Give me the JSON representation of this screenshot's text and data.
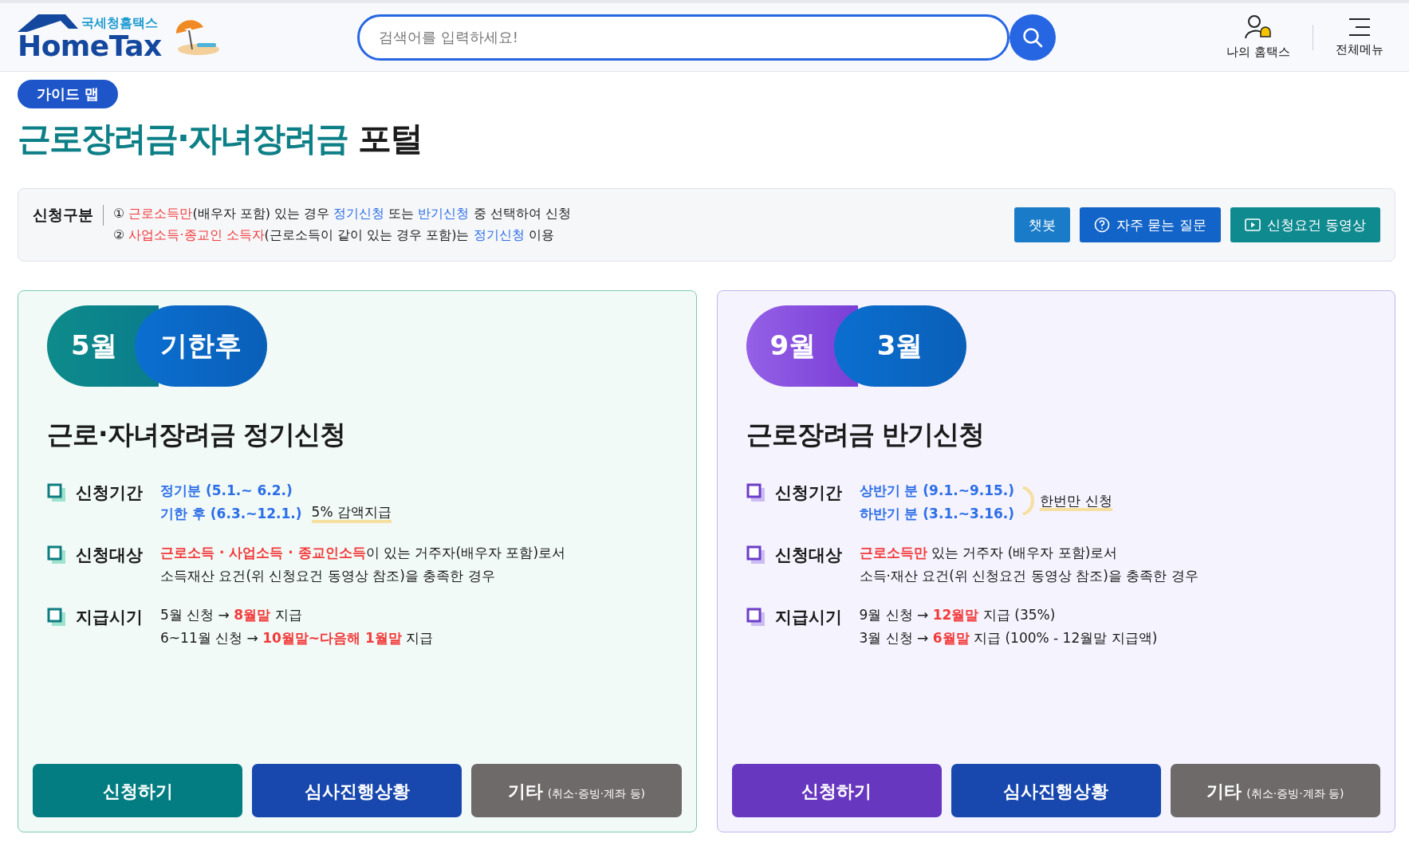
{
  "header": {
    "logo_small": "국세청홈택스",
    "logo_big": "HomeTax",
    "search": {
      "placeholder": "검색어를 입력하세요!"
    },
    "links": [
      {
        "label": "나의 홈택스",
        "kind": "user"
      },
      {
        "label": "전체메뉴",
        "kind": "menu"
      }
    ]
  },
  "badge": "가이드 맵",
  "title": {
    "accent": "근로장려금·자녀장려금",
    "rest": "포털"
  },
  "info": {
    "label": "신청구분",
    "lines": [
      [
        {
          "text": "① ",
          "kind": "plain"
        },
        {
          "text": "근로소득만",
          "kind": "red"
        },
        {
          "text": "(배우자 포함) 있는 경우 ",
          "kind": "plain"
        },
        {
          "text": "정기신청",
          "kind": "blue"
        },
        {
          "text": " 또는 ",
          "kind": "plain"
        },
        {
          "text": "반기신청",
          "kind": "blue"
        },
        {
          "text": " 중 선택하여 신청",
          "kind": "plain"
        }
      ],
      [
        {
          "text": "② ",
          "kind": "plain"
        },
        {
          "text": "사업소득·종교인 소득자",
          "kind": "red"
        },
        {
          "text": "(근로소득이 같이 있는 경우 포함)는 ",
          "kind": "plain"
        },
        {
          "text": "정기신청",
          "kind": "blue"
        },
        {
          "text": " 이용",
          "kind": "plain"
        }
      ]
    ],
    "buttons": [
      {
        "label": "챗봇",
        "kind": "chatbot"
      },
      {
        "label": "자주 묻는 질문",
        "kind": "faq"
      },
      {
        "label": "신청요건 동영상",
        "kind": "video"
      }
    ]
  },
  "cards": [
    {
      "kind": "regular",
      "pill": [
        "5월",
        "기한후"
      ],
      "title": "근로·자녀장려금 정기신청",
      "rows": [
        {
          "label": "신청기간",
          "lines": [
            [
              {
                "text": "정기분 (5.1.~ 6.2.)",
                "kind": "blue"
              }
            ],
            [
              {
                "text": "기한 후 (6.3.~12.1.)",
                "kind": "blue"
              }
            ]
          ],
          "note": "5% 감액지급",
          "kind": "inline"
        },
        {
          "label": "신청대상",
          "lines": [
            [
              {
                "text": "근로소득 · 사업소득 · 종교인소득",
                "kind": "red"
              },
              {
                "text": "이 있는 거주자(배우자 포함)로서",
                "kind": "plain"
              }
            ],
            [
              {
                "text": "소득재산 요건(위 신청요건 동영상 참조)을 충족한 경우",
                "kind": "plain"
              }
            ]
          ]
        },
        {
          "label": "지급시기",
          "lines": [
            [
              {
                "text": "5월 신청 → ",
                "kind": "plain"
              },
              {
                "text": "8월말",
                "kind": "red"
              },
              {
                "text": " 지급",
                "kind": "plain"
              }
            ],
            [
              {
                "text": "6~11월 신청 → ",
                "kind": "plain"
              },
              {
                "text": "10월말~다음해 1월말",
                "kind": "red"
              },
              {
                "text": " 지급",
                "kind": "plain"
              }
            ]
          ]
        }
      ],
      "buttons": [
        {
          "label": "신청하기",
          "kind": "apply"
        },
        {
          "label": "심사진행상황",
          "kind": "status"
        },
        {
          "label": "기타",
          "sub": "(취소·증빙·계좌 등)",
          "kind": "other"
        }
      ]
    },
    {
      "kind": "halfyear",
      "pill": [
        "9월",
        "3월"
      ],
      "title": "근로장려금 반기신청",
      "rows": [
        {
          "label": "신청기간",
          "lines": [
            [
              {
                "text": "상반기 분 (9.1.~9.15.)",
                "kind": "blue"
              }
            ],
            [
              {
                "text": "하반기 분 (3.1.~3.16.)",
                "kind": "blue"
              }
            ]
          ],
          "note": "한번만 신청",
          "kind": "brace"
        },
        {
          "label": "신청대상",
          "lines": [
            [
              {
                "text": "근로소득만",
                "kind": "red"
              },
              {
                "text": " 있는 거주자 (배우자 포함)로서",
                "kind": "plain"
              }
            ],
            [
              {
                "text": "소득·재산 요건(위 신청요건 동영상 참조)을 충족한 경우",
                "kind": "plain"
              }
            ]
          ]
        },
        {
          "label": "지급시기",
          "lines": [
            [
              {
                "text": "9월 신청 → ",
                "kind": "plain"
              },
              {
                "text": "12월말",
                "kind": "red"
              },
              {
                "text": " 지급 (35%)",
                "kind": "plain"
              }
            ],
            [
              {
                "text": "3월 신청 → ",
                "kind": "plain"
              },
              {
                "text": "6월말",
                "kind": "red"
              },
              {
                "text": " 지급 (100% - 12월말 지급액)",
                "kind": "plain"
              }
            ]
          ]
        }
      ],
      "buttons": [
        {
          "label": "신청하기",
          "kind": "apply"
        },
        {
          "label": "심사진행상황",
          "kind": "status"
        },
        {
          "label": "기타",
          "sub": "(취소·증빙·계좌 등)",
          "kind": "other"
        }
      ]
    }
  ]
}
